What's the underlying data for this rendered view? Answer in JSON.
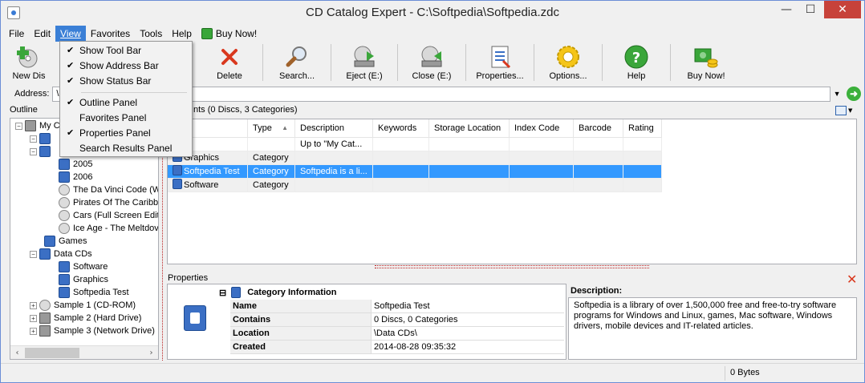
{
  "window": {
    "title": "CD Catalog Expert - C:\\Softpedia\\Softpedia.zdc"
  },
  "window_controls": {
    "minimize": "—",
    "maximize": "☐",
    "close": "✕"
  },
  "menu": {
    "file": "File",
    "edit": "Edit",
    "view": "View",
    "favorites": "Favorites",
    "tools": "Tools",
    "help": "Help",
    "buynow": "Buy Now!"
  },
  "view_menu": {
    "items": [
      {
        "label": "Show Tool Bar",
        "checked": "✔"
      },
      {
        "label": "Show Address Bar",
        "checked": "✔"
      },
      {
        "label": "Show Status Bar",
        "checked": "✔"
      },
      {
        "label": "Outline Panel",
        "checked": "✔"
      },
      {
        "label": "Favorites Panel",
        "checked": ""
      },
      {
        "label": "Properties Panel",
        "checked": "✔"
      },
      {
        "label": "Search Results Panel",
        "checked": ""
      }
    ]
  },
  "toolbar": {
    "new_disc": "New Dis",
    "delete": "Delete",
    "search": "Search...",
    "eject": "Eject (E:)",
    "close": "Close (E:)",
    "properties": "Properties...",
    "options": "Options...",
    "help": "Help",
    "buynow": "Buy Now!"
  },
  "address": {
    "label": "Address:",
    "value": "\\Da"
  },
  "outline": {
    "title": "Outline",
    "items": {
      "root": "My C",
      "y2005": "2005",
      "y2006": "2006",
      "davinci": "The Da Vinci Code (W",
      "pirates": "Pirates Of The Caribb",
      "cars": "Cars (Full Screen Edit",
      "iceage": "Ice Age - The Meltdov",
      "games": "Games",
      "datacds": "Data CDs",
      "software": "Software",
      "graphics": "Graphics",
      "softpedia": "Softpedia Test",
      "sample1": "Sample 1 (CD-ROM)",
      "sample2": "Sample 2 (Hard Drive)",
      "sample3": "Sample 3 (Network Drive)"
    }
  },
  "contents": {
    "title": "nts (0 Discs, 3 Categories)",
    "columns": [
      "e",
      "Type",
      "Description",
      "Keywords",
      "Storage Location",
      "Index Code",
      "Barcode",
      "Rating"
    ],
    "rows": [
      [
        "",
        "",
        "Up to \"My Cat...",
        "",
        "",
        "",
        "",
        ""
      ],
      [
        "Graphics",
        "Category",
        "",
        "",
        "",
        "",
        "",
        ""
      ],
      [
        "Softpedia Test",
        "Category",
        "Softpedia is a li...",
        "",
        "",
        "",
        "",
        ""
      ],
      [
        "Software",
        "Category",
        "",
        "",
        "",
        "",
        "",
        ""
      ]
    ]
  },
  "properties": {
    "title": "Properties",
    "close_icon": "✕",
    "section": "Category Information",
    "collapse": "⊟",
    "rows": [
      {
        "key": "Name",
        "value": "Softpedia Test"
      },
      {
        "key": "Contains",
        "value": "0 Discs, 0 Categories"
      },
      {
        "key": "Location",
        "value": "\\Data CDs\\"
      },
      {
        "key": "Created",
        "value": "2014-08-28 09:35:32"
      }
    ]
  },
  "description": {
    "title": "Description:",
    "text": "Softpedia is a library of over 1,500,000 free and free-to-try software programs for Windows and Linux, games, Mac software, Windows drivers, mobile devices and IT-related articles."
  },
  "status": {
    "size": "0 Bytes"
  },
  "colors": {
    "selection": "#3399ff",
    "menu_active": "#3a7fd6",
    "close_red": "#c7423a"
  }
}
